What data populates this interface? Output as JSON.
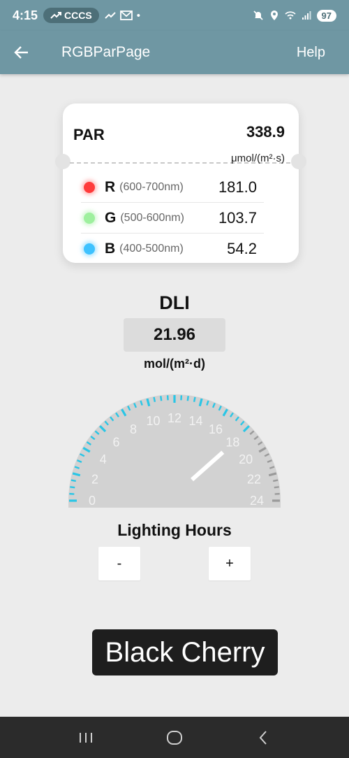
{
  "status_bar": {
    "time": "4:15",
    "pill_text": "CCCS",
    "battery": "97"
  },
  "app_bar": {
    "title": "RGBParPage",
    "help_label": "Help",
    "back_icon": "arrow-left-icon"
  },
  "par_card": {
    "label": "PAR",
    "value": "338.9",
    "unit": "μmol/(m²·s)",
    "bands": [
      {
        "letter": "R",
        "range": "(600-700nm)",
        "value": "181.0",
        "color": "#ff3b3b"
      },
      {
        "letter": "G",
        "range": "(500-600nm)",
        "value": "103.7",
        "color": "#9ef09e"
      },
      {
        "letter": "B",
        "range": "(400-500nm)",
        "value": "54.2",
        "color": "#3ec2ff"
      }
    ]
  },
  "dli": {
    "title": "DLI",
    "value": "21.96",
    "unit": "mol/(m²·d)"
  },
  "gauge": {
    "min": 0,
    "max": 24,
    "value": 18,
    "tick_labels": [
      "0",
      "2",
      "4",
      "6",
      "8",
      "10",
      "12",
      "14",
      "16",
      "18",
      "20",
      "22",
      "24"
    ],
    "active_color": "#29c6e6",
    "inactive_color": "#9a9a9a",
    "face_color": "#d2d2d2"
  },
  "lighting": {
    "label": "Lighting Hours",
    "minus_label": "-",
    "plus_label": "+"
  },
  "toast": {
    "text": "Black Cherry"
  }
}
